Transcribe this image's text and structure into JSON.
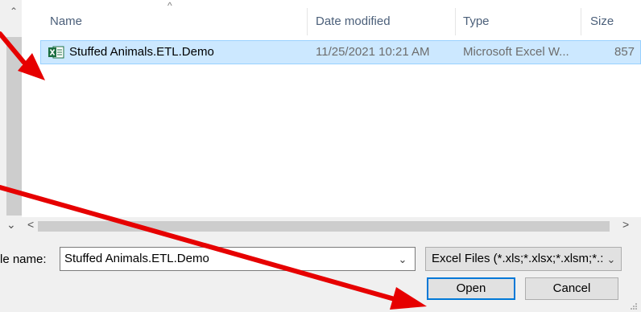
{
  "columns": {
    "name": "Name",
    "date_modified": "Date modified",
    "type": "Type",
    "size": "Size"
  },
  "files": [
    {
      "name": "Stuffed Animals.ETL.Demo",
      "date_modified": "11/25/2021 10:21 AM",
      "type": "Microsoft Excel W...",
      "size": "857",
      "icon": "excel-file-icon"
    }
  ],
  "file_name": {
    "label": "le name:",
    "value": "Stuffed Animals.ETL.Demo"
  },
  "file_type": {
    "value": "Excel Files (*.xls;*.xlsx;*.xlsm;*.:"
  },
  "buttons": {
    "open": "Open",
    "cancel": "Cancel"
  },
  "colors": {
    "selection": "#cce8ff",
    "selection_border": "#99d1ff",
    "annotation_arrow": "#e60000",
    "header_text": "#4c607a",
    "excel_green": "#1d6f42"
  }
}
